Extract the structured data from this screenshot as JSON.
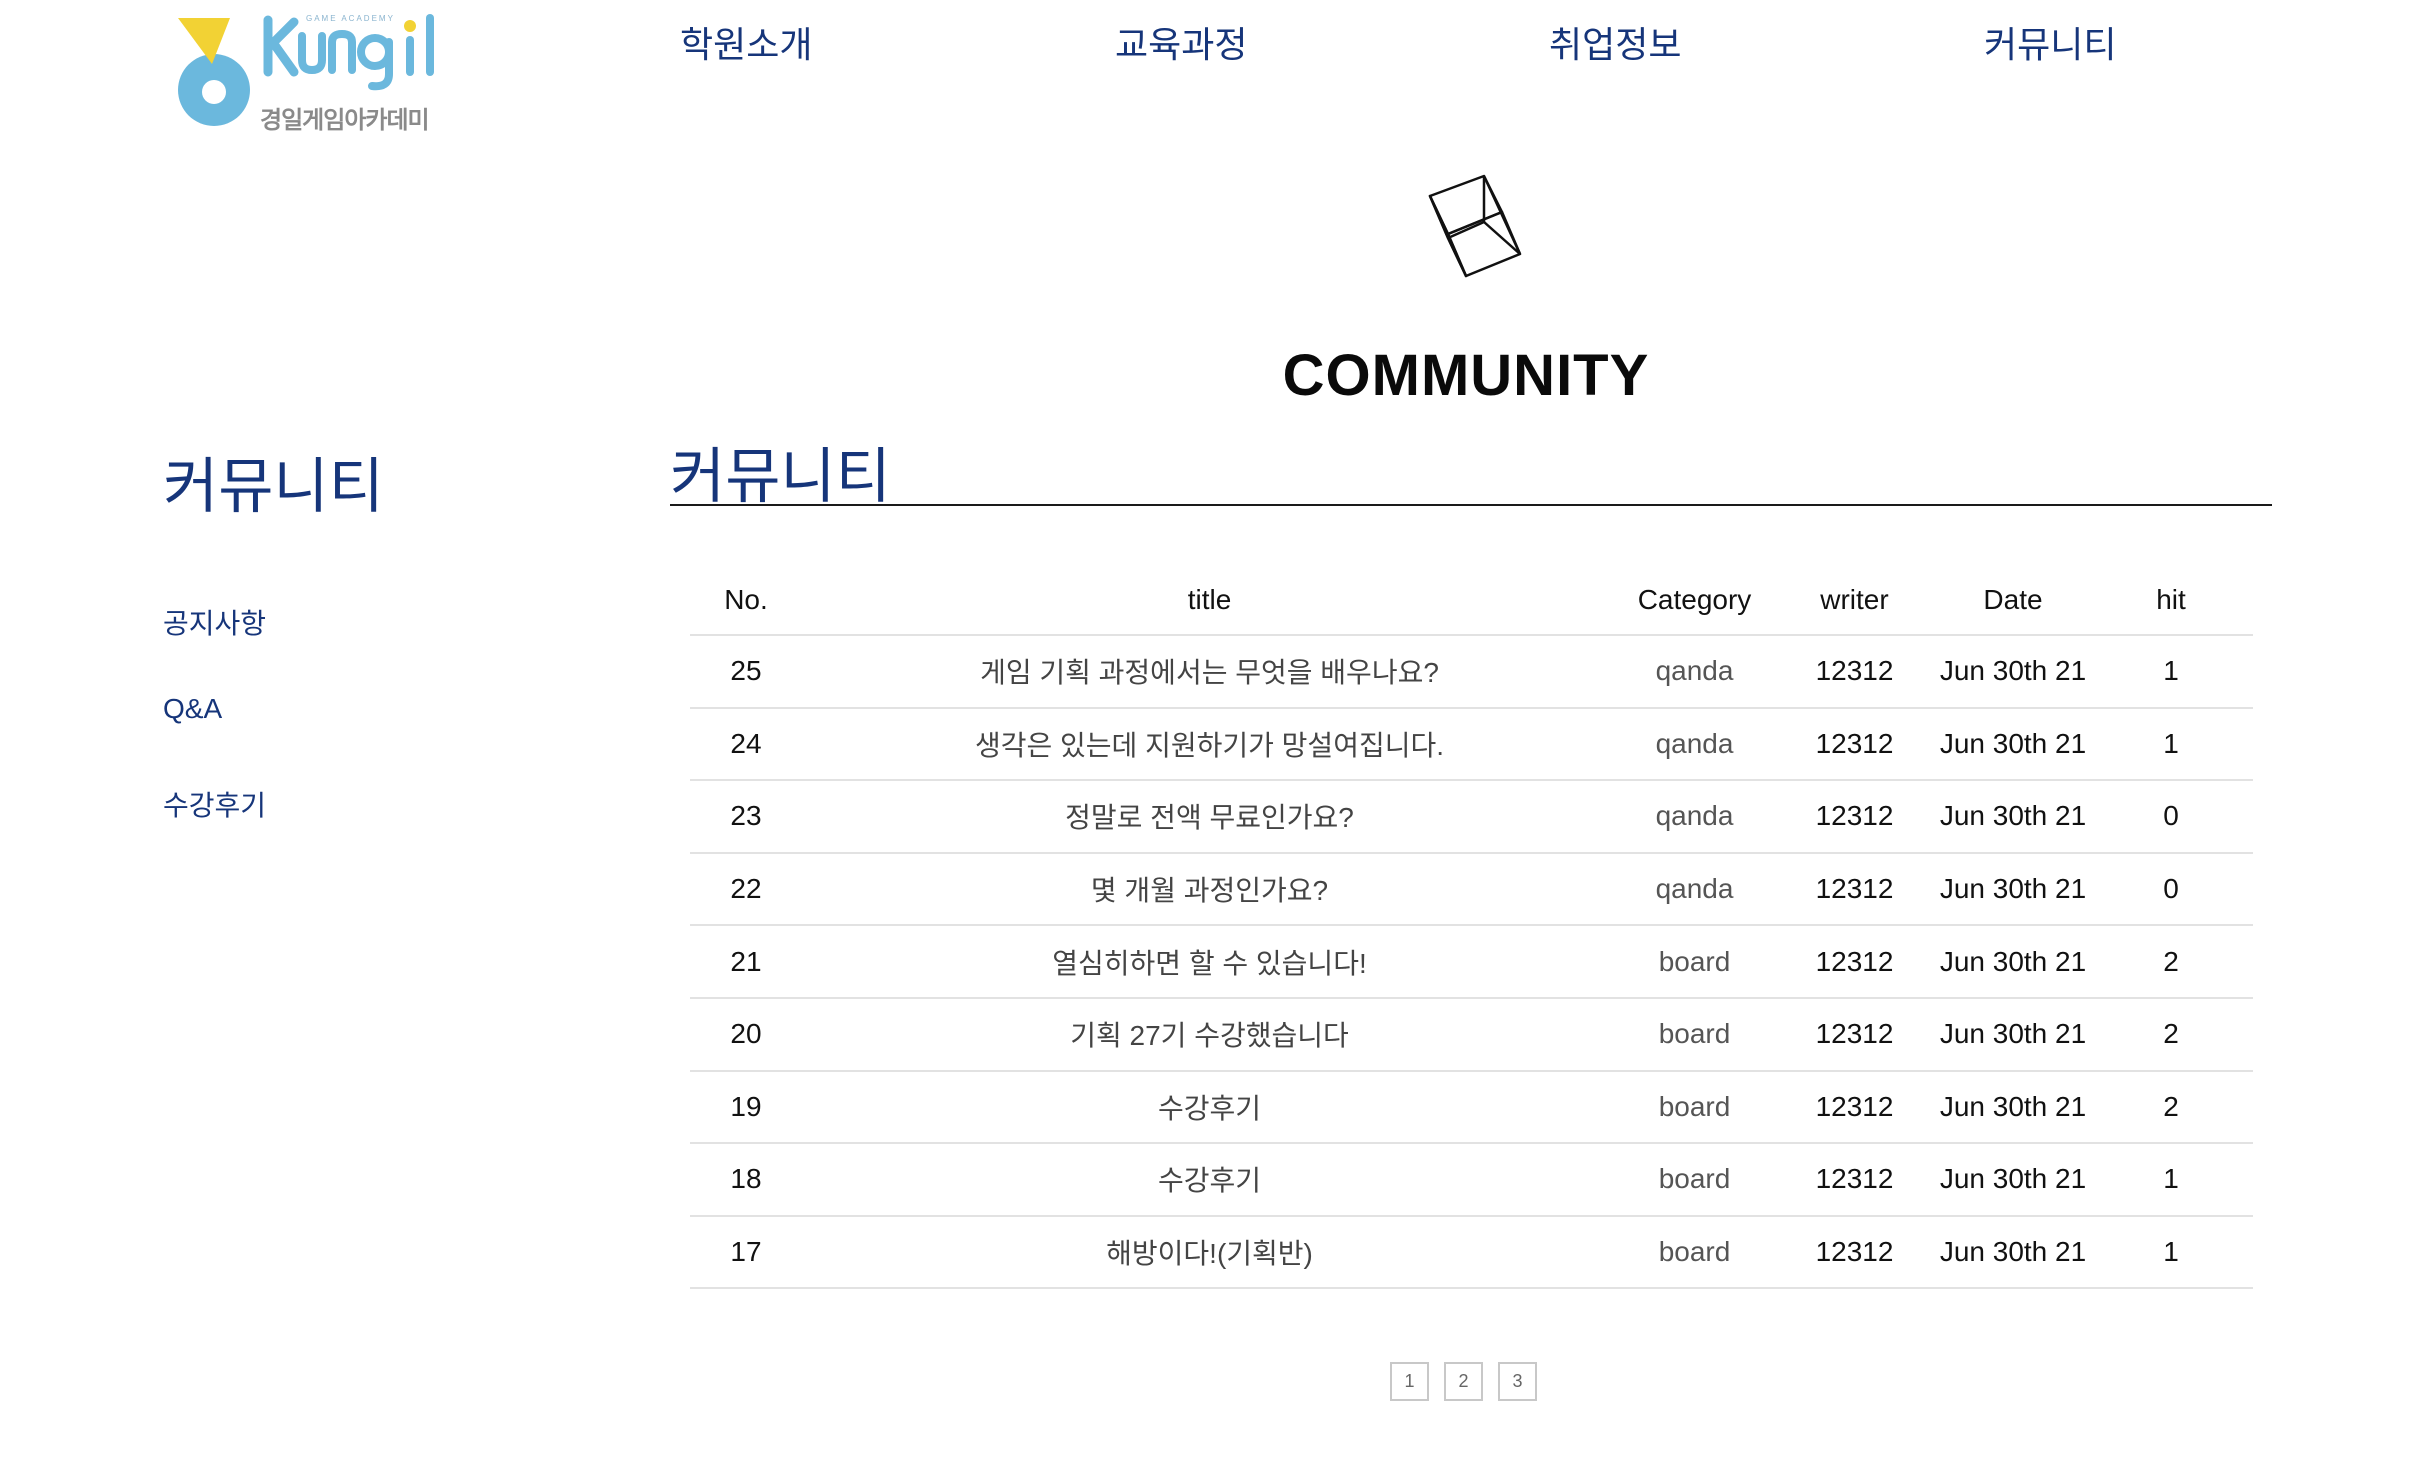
{
  "brand": {
    "logo_name": "Kyungil",
    "logo_tagline": "GAME ACADEMY",
    "logo_korean": "경일게임아카데미",
    "colors": {
      "blue": "#6bb8dd",
      "yellow": "#f2d234",
      "navy": "#16357a"
    }
  },
  "nav": {
    "items": [
      {
        "label": "학원소개"
      },
      {
        "label": "교육과정"
      },
      {
        "label": "취업정보"
      },
      {
        "label": "커뮤니티"
      }
    ]
  },
  "hero": {
    "icon": "cube-icon",
    "title": "COMMUNITY"
  },
  "sidebar": {
    "title": "커뮤니티",
    "items": [
      {
        "label": "공지사항"
      },
      {
        "label": "Q&A"
      },
      {
        "label": "수강후기"
      }
    ]
  },
  "main": {
    "section_title": "커뮤니티",
    "table": {
      "headers": [
        "No.",
        "title",
        "Category",
        "writer",
        "Date",
        "hit"
      ],
      "rows": [
        {
          "no": "25",
          "title": "게임 기획 과정에서는 무엇을 배우나요?",
          "category": "qanda",
          "writer": "12312",
          "date": "Jun 30th 21",
          "hit": "1"
        },
        {
          "no": "24",
          "title": "생각은 있는데 지원하기가 망설여집니다.",
          "category": "qanda",
          "writer": "12312",
          "date": "Jun 30th 21",
          "hit": "1"
        },
        {
          "no": "23",
          "title": "정말로 전액 무료인가요?",
          "category": "qanda",
          "writer": "12312",
          "date": "Jun 30th 21",
          "hit": "0"
        },
        {
          "no": "22",
          "title": "몇 개월 과정인가요?",
          "category": "qanda",
          "writer": "12312",
          "date": "Jun 30th 21",
          "hit": "0"
        },
        {
          "no": "21",
          "title": "열심히하면 할 수 있습니다!",
          "category": "board",
          "writer": "12312",
          "date": "Jun 30th 21",
          "hit": "2"
        },
        {
          "no": "20",
          "title": "기획 27기 수강했습니다",
          "category": "board",
          "writer": "12312",
          "date": "Jun 30th 21",
          "hit": "2"
        },
        {
          "no": "19",
          "title": "수강후기",
          "category": "board",
          "writer": "12312",
          "date": "Jun 30th 21",
          "hit": "2"
        },
        {
          "no": "18",
          "title": "수강후기",
          "category": "board",
          "writer": "12312",
          "date": "Jun 30th 21",
          "hit": "1"
        },
        {
          "no": "17",
          "title": "해방이다!(기획반)",
          "category": "board",
          "writer": "12312",
          "date": "Jun 30th 21",
          "hit": "1"
        }
      ]
    },
    "pagination": [
      "1",
      "2",
      "3"
    ]
  }
}
